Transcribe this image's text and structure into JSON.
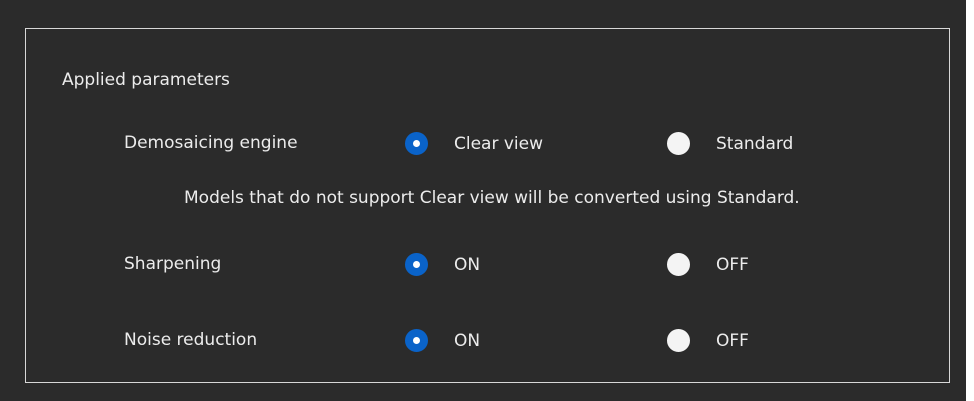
{
  "group": {
    "title": "Applied parameters"
  },
  "rows": {
    "demosaicing": {
      "label": "Demosaicing engine",
      "option_a": "Clear view",
      "option_b": "Standard",
      "selected": "Clear view",
      "note": "Models that do not support Clear view will be converted using Standard."
    },
    "sharpening": {
      "label": "Sharpening",
      "option_a": "ON",
      "option_b": "OFF",
      "selected": "ON"
    },
    "noise_reduction": {
      "label": "Noise reduction",
      "option_a": "ON",
      "option_b": "OFF",
      "selected": "ON"
    }
  },
  "colors": {
    "background": "#2b2b2b",
    "accent": "#0a63c9",
    "text": "#ececec",
    "border": "#d8d8d8"
  },
  "icons": {
    "radio_checked": "radio-checked-icon",
    "radio_unchecked": "radio-unchecked-icon"
  }
}
